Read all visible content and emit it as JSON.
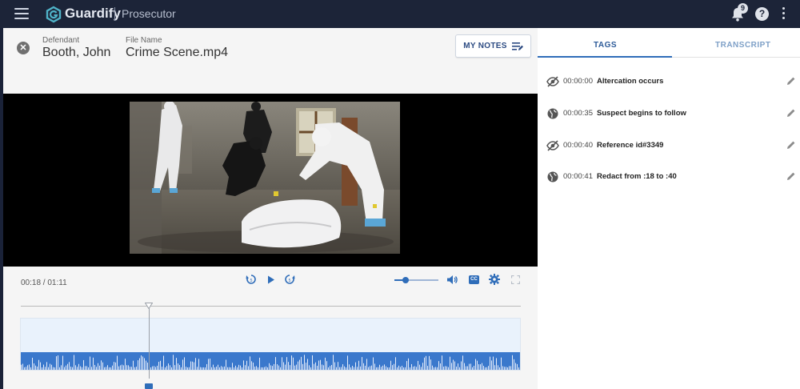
{
  "app": {
    "brand": "Guardify",
    "product": "Prosecutor",
    "notification_count": "9",
    "help_label": "?"
  },
  "case": {
    "defendant_label": "Defendant",
    "defendant_name": "Booth, John",
    "file_label": "File Name",
    "file_name": "Crime Scene.mp4",
    "notes_button": "MY NOTES"
  },
  "player": {
    "time": "00:18 / 01:11",
    "progress": 0.25,
    "volume": 0.25,
    "cc_label": "CC"
  },
  "tabs": [
    {
      "label": "TAGS",
      "active": true
    },
    {
      "label": "TRANSCRIPT",
      "active": false
    }
  ],
  "tags": [
    {
      "time": "00:00:00",
      "text": "Altercation occurs",
      "icon": "eye-off-icon"
    },
    {
      "time": "00:00:35",
      "text": "Suspect begins to follow",
      "icon": "globe-icon"
    },
    {
      "time": "00:00:40",
      "text": "Reference id#3349",
      "icon": "eye-off-icon"
    },
    {
      "time": "00:00:41",
      "text": "Redact from :18 to :40",
      "icon": "globe-icon"
    }
  ],
  "colors": {
    "accent": "#2f6db9",
    "topbar": "#1c2438",
    "wave": "#3a78cc"
  }
}
